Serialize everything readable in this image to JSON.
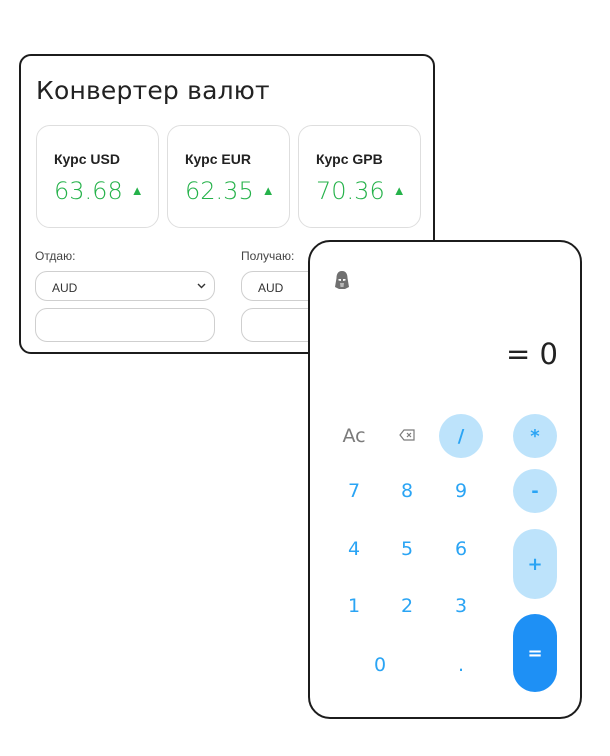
{
  "converter": {
    "title": "Конвертер валют",
    "rates": [
      {
        "label": "Курс USD",
        "value": "63.68",
        "trend_icon": "▲"
      },
      {
        "label": "Курс EUR",
        "value": "62.35",
        "trend_icon": "▲"
      },
      {
        "label": "Курс GPB",
        "value": "70.36",
        "trend_icon": "▲"
      }
    ],
    "give": {
      "label": "Отдаю:",
      "selected": "AUD",
      "amount": ""
    },
    "receive": {
      "label": "Получаю:",
      "selected": "AUD",
      "amount": ""
    },
    "trend_color": "#25b24a"
  },
  "calculator": {
    "display": "= 0",
    "logo_icon": "vader-helmet-icon",
    "keys": {
      "clear": "Ac",
      "backspace": "⌫",
      "divide": "/",
      "multiply": "*",
      "minus": "-",
      "plus": "+",
      "equals": "=",
      "seven": "7",
      "eight": "8",
      "nine": "9",
      "four": "4",
      "five": "5",
      "six": "6",
      "one": "1",
      "two": "2",
      "three": "3",
      "zero": "0",
      "dot": "."
    },
    "accent_color": "#2aa4f4",
    "equals_color": "#1e90f5"
  }
}
